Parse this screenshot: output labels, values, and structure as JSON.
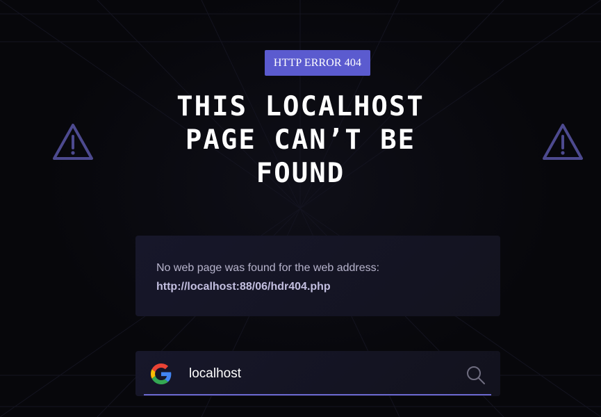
{
  "badge": {
    "label": "HTTP ERROR 404"
  },
  "title": {
    "line1": "THIS LOCALHOST",
    "line2": "PAGE CAN’T BE",
    "line3": "FOUND"
  },
  "info": {
    "message": "No web page was found for the web address:",
    "url": "http://localhost:88/06/hdr404.php"
  },
  "search": {
    "value": "localhost",
    "engine_icon": "google-icon",
    "action_icon": "search-icon"
  },
  "icons": {
    "warning_left": "warning-icon",
    "warning_right": "warning-icon"
  },
  "colors": {
    "background": "#07070b",
    "accent": "#5b5bcf",
    "warning": "#4d4a8f",
    "card": "#17172a"
  }
}
